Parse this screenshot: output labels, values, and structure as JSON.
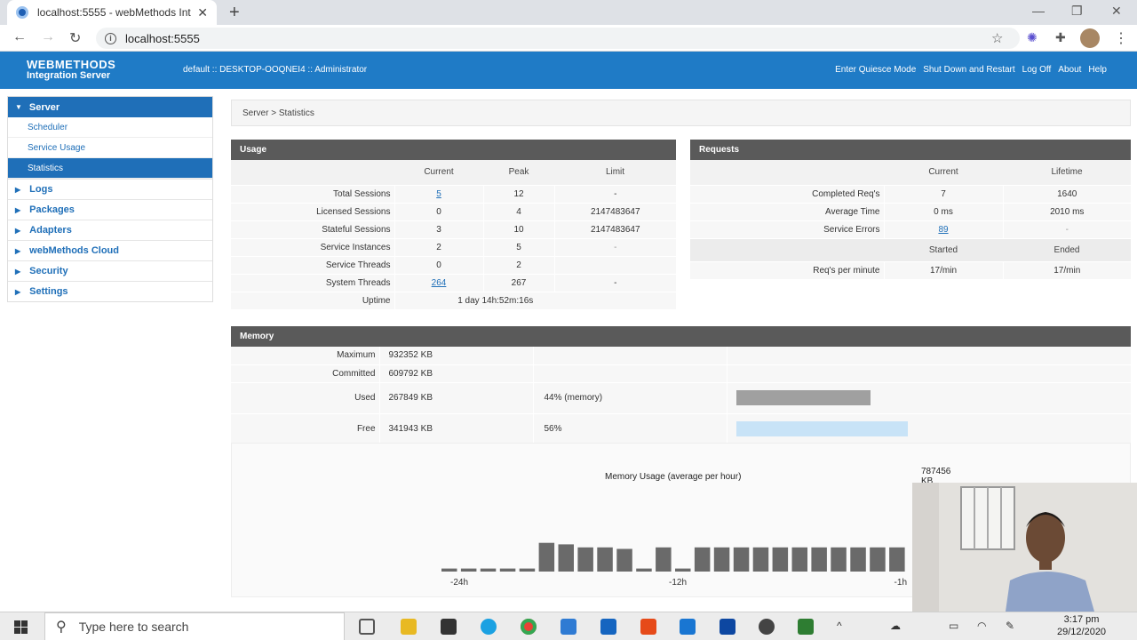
{
  "browser": {
    "tab_title": "localhost:5555 - webMethods Int",
    "url": "localhost:5555"
  },
  "header": {
    "logo_line1": "WEBMETHODS",
    "logo_line2": "Integration Server",
    "user_info": "default :: DESKTOP-OOQNEI4 :: Administrator",
    "links": [
      "Enter Quiesce Mode",
      "Shut Down and Restart",
      "Log Off",
      "About",
      "Help"
    ]
  },
  "sidebar": {
    "server_label": "Server",
    "sub_items": [
      "Scheduler",
      "Service Usage",
      "Statistics"
    ],
    "active_sub": "Statistics",
    "items": [
      "Logs",
      "Packages",
      "Adapters",
      "webMethods Cloud",
      "Security",
      "Settings"
    ]
  },
  "breadcrumb": "Server > Statistics",
  "usage": {
    "title": "Usage",
    "columns": [
      "",
      "Current",
      "Peak",
      "Limit"
    ],
    "rows": [
      {
        "label": "Total Sessions",
        "current": "5",
        "peak": "12",
        "limit": "-",
        "link": true
      },
      {
        "label": "Licensed Sessions",
        "current": "0",
        "peak": "4",
        "limit": "2147483647",
        "link": false
      },
      {
        "label": "Stateful Sessions",
        "current": "3",
        "peak": "10",
        "limit": "2147483647",
        "link": false
      },
      {
        "label": "Service Instances",
        "current": "2",
        "peak": "5",
        "limit": "-",
        "link": false
      },
      {
        "label": "Service Threads",
        "current": "0",
        "peak": "2",
        "limit": "",
        "link": false
      },
      {
        "label": "System Threads",
        "current": "264",
        "peak": "267",
        "limit": "-",
        "link": true
      }
    ],
    "uptime_label": "Uptime",
    "uptime_value": "1 day 14h:52m:16s"
  },
  "requests": {
    "title": "Requests",
    "columns": [
      "",
      "Current",
      "Lifetime"
    ],
    "rows": [
      {
        "label": "Completed Req's",
        "current": "7",
        "lifetime": "1640"
      },
      {
        "label": "Average Time",
        "current": "0 ms",
        "lifetime": "2010 ms"
      },
      {
        "label": "Service Errors",
        "current": "89",
        "lifetime": "-"
      }
    ],
    "sub_columns": [
      "Started",
      "Ended"
    ],
    "rpm_label": "Req's per minute",
    "rpm_started": "17/min",
    "rpm_ended": "17/min"
  },
  "memory": {
    "title": "Memory",
    "maximum_label": "Maximum",
    "maximum": "932352 KB",
    "committed_label": "Committed",
    "committed": "609792 KB",
    "used_label": "Used",
    "used": "267849 KB",
    "used_pct_text": "44% (memory)",
    "used_fraction": 0.44,
    "free_label": "Free",
    "free": "341943 KB",
    "free_pct_text": "56%",
    "free_fraction": 0.56,
    "used_color": "#a0a0a0",
    "free_color": "#c8e3f7"
  },
  "chart_data": {
    "type": "bar",
    "title": "Memory Usage (average per hour)",
    "max_label": "787456 KB",
    "x_tick_labels": [
      "-24h",
      "-12h",
      "-1h"
    ],
    "values": [
      0.1,
      0.1,
      0.1,
      0.1,
      0.1,
      0.95,
      0.9,
      0.8,
      0.8,
      0.75,
      0.1,
      0.8,
      0.1,
      0.8,
      0.8,
      0.8,
      0.8,
      0.8,
      0.8,
      0.8,
      0.8,
      0.8,
      0.8,
      0.8
    ],
    "bar_color": "#6a6a6a"
  },
  "taskbar": {
    "search_placeholder": "Type here to search",
    "time": "3:17 pm",
    "date": "29/12/2020"
  }
}
